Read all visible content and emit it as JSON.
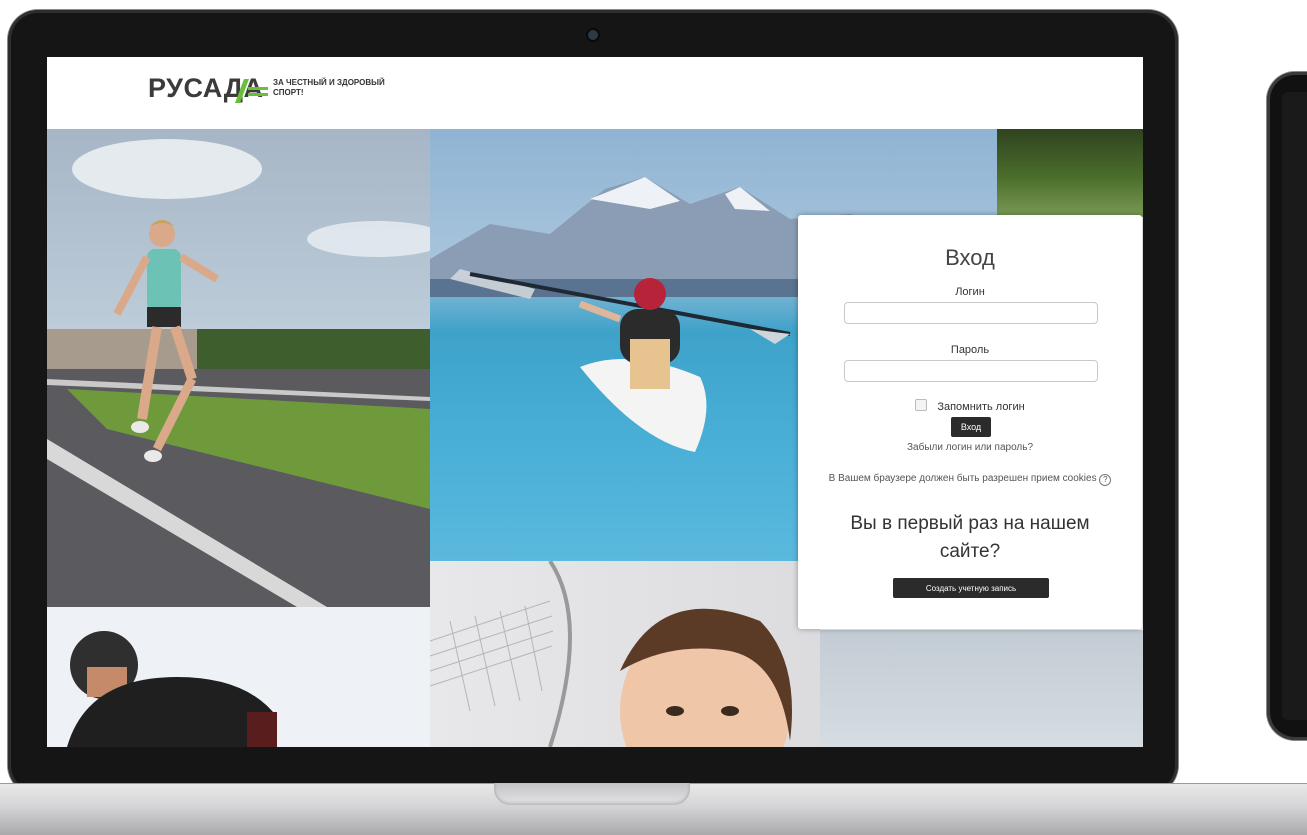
{
  "brand": {
    "logo_text": "РУСАДА",
    "tagline": "ЗА ЧЕСТНЫЙ И ЗДОРОВЫЙ СПОРТ!",
    "logo_color": "#3b3b3b",
    "accent_color": "#6abf3a"
  },
  "login": {
    "title": "Вход",
    "username_label": "Логин",
    "username_value": "",
    "password_label": "Пароль",
    "password_value": "",
    "remember_label": "Запомнить логин",
    "remember_checked": false,
    "submit_label": "Вход",
    "forgot_link": "Забыли логин или пароль?",
    "cookies_note": "В Вашем браузере должен быть разрешен прием cookies",
    "help_icon": "question-circle-icon",
    "first_time_heading": "Вы в первый раз на нашем сайте?",
    "create_account_label": "Создать учетную запись"
  },
  "colors": {
    "button_bg": "#2b2b2b",
    "card_bg": "#ffffff"
  }
}
